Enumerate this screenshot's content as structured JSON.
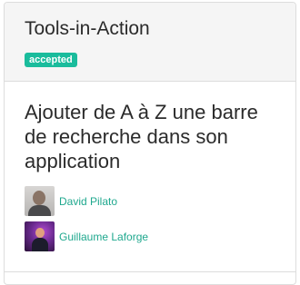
{
  "session": {
    "track": "Tools-in-Action",
    "status_badge": "accepted",
    "title": "Ajouter de A à Z une barre de recherche dans son application",
    "speakers": [
      {
        "name": "David Pilato",
        "avatar": "speaker-photo"
      },
      {
        "name": "Guillaume Laforge",
        "avatar": "speaker-photo"
      }
    ]
  },
  "colors": {
    "accent": "#1abc9c",
    "link": "#1fa88e",
    "header_bg": "#f5f5f5",
    "border": "#dddddd"
  }
}
